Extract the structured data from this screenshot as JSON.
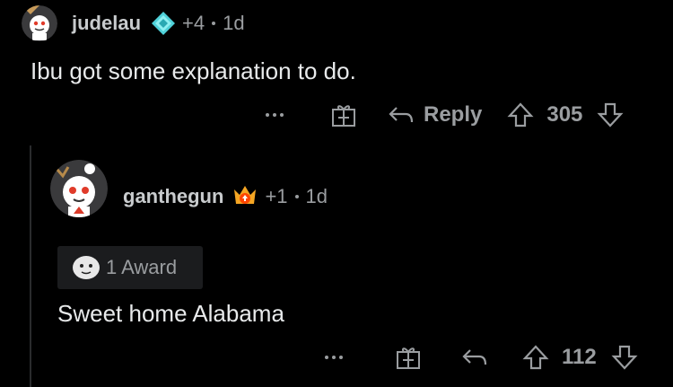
{
  "comment": {
    "username": "judelau",
    "score_bonus": "+4",
    "age": "1d",
    "body": "Ibu got some explanation to do.",
    "reply_label": "Reply",
    "votes": "305"
  },
  "reply": {
    "username": "ganthegun",
    "score_bonus": "+1",
    "age": "1d",
    "award_label": "1 Award",
    "body": "Sweet home Alabama",
    "votes": "112"
  },
  "colors": {
    "background": "#000000",
    "text": "#e8eaeb",
    "muted": "#9a9da0",
    "diamond_badge": "#4fd1d9",
    "flair_badge": "#f5a623"
  }
}
